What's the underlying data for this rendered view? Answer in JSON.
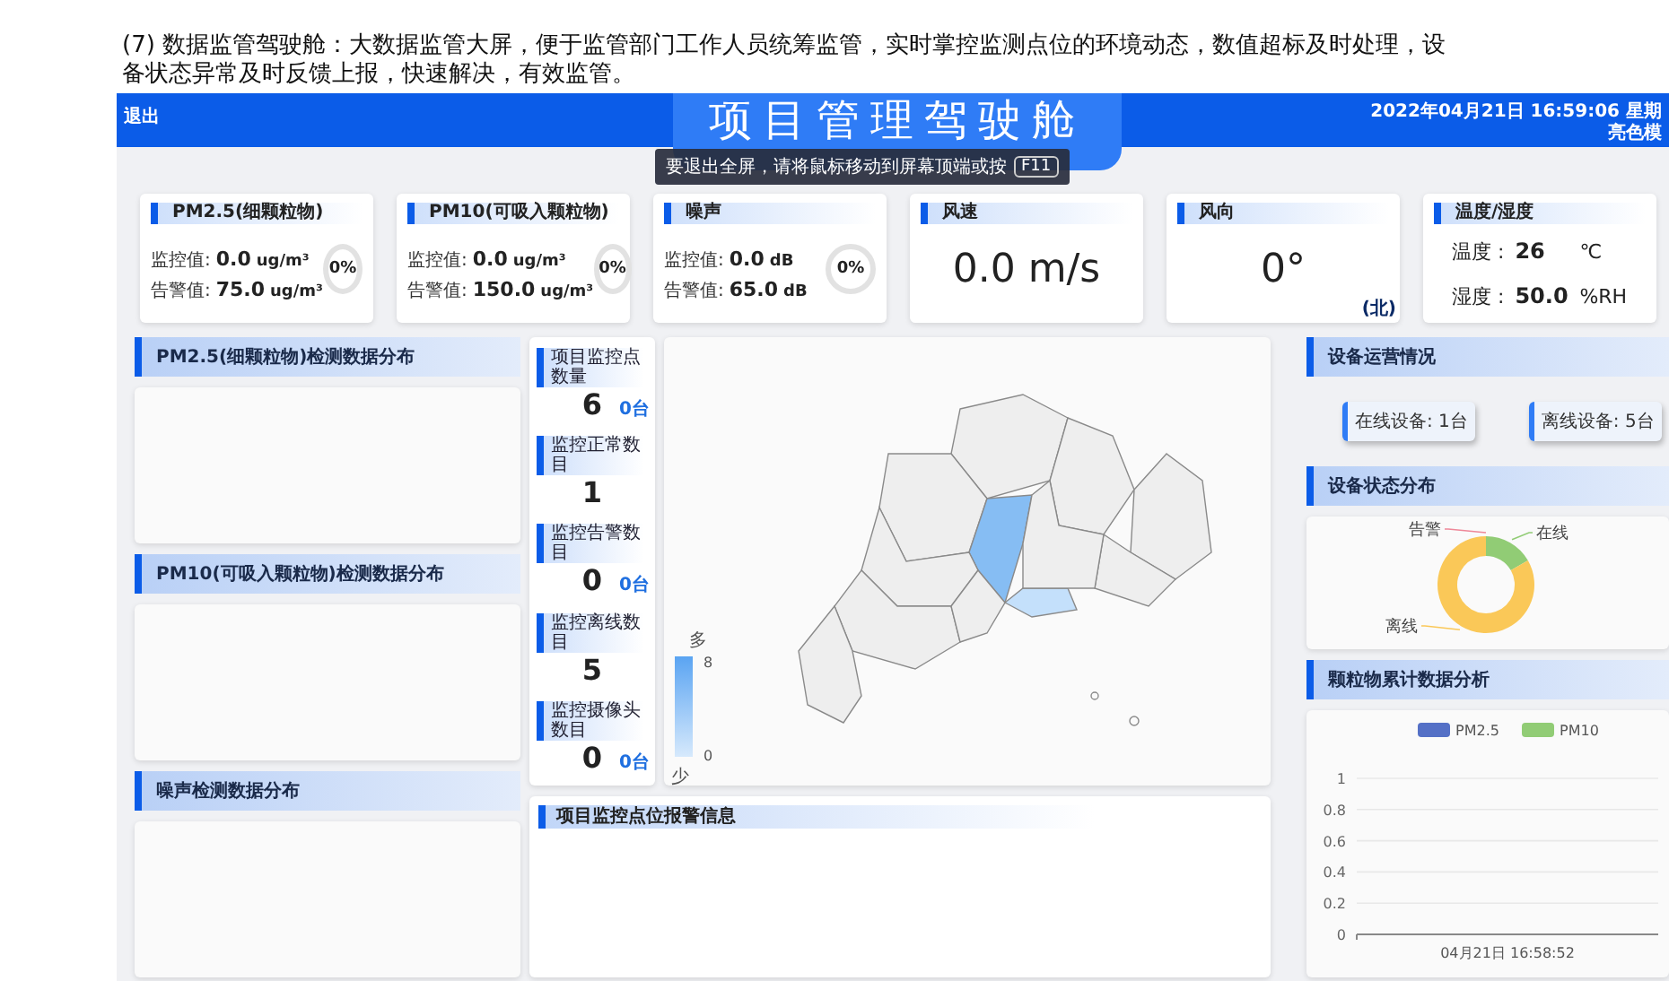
{
  "caption": "(7) 数据监管驾驶舱：大数据监管大屏，便于监管部门工作人员统筹监管，实时掌控监测点位的环境动态，数值超标及时处理，设备状态异常及时反馈上报，快速解决，有效监管。",
  "header": {
    "exit": "退出",
    "title": "项目管理驾驶舱",
    "tooltip": {
      "text": "要退出全屏，请将鼠标移动到屏幕顶端或按",
      "key": "F11"
    },
    "datetime": "2022年04月21日 16:59:06 星期",
    "theme": "亮色模"
  },
  "cards": [
    {
      "kind": "gauge",
      "title": "PM2.5(细颗粒物)",
      "rows": [
        {
          "label": "监控值:",
          "value": "0.0",
          "unit": "ug/m³"
        },
        {
          "label": "告警值:",
          "value": "75.0",
          "unit": "ug/m³"
        }
      ],
      "percent": "0%"
    },
    {
      "kind": "gauge",
      "title": "PM10(可吸入颗粒物)",
      "rows": [
        {
          "label": "监控值:",
          "value": "0.0",
          "unit": "ug/m³"
        },
        {
          "label": "告警值:",
          "value": "150.0",
          "unit": "ug/m³"
        }
      ],
      "percent": "0%"
    },
    {
      "kind": "gauge",
      "title": "噪声",
      "rows": [
        {
          "label": "监控值:",
          "value": "0.0",
          "unit": "dB"
        },
        {
          "label": "告警值:",
          "value": "65.0",
          "unit": "dB"
        }
      ],
      "percent": "0%"
    },
    {
      "kind": "big",
      "title": "风速",
      "value": "0.0 m/s"
    },
    {
      "kind": "big",
      "title": "风向",
      "value": "0°",
      "note": "(北)"
    },
    {
      "kind": "pairs",
      "title": "温度/湿度",
      "rows": [
        {
          "label": "温度 :",
          "value": "26",
          "unit": "℃"
        },
        {
          "label": "湿度 :",
          "value": "50.0",
          "unit": "%RH"
        }
      ]
    }
  ],
  "left_panels": [
    {
      "title": "PM2.5(细颗粒物)检测数据分布"
    },
    {
      "title": "PM10(可吸入颗粒物)检测数据分布"
    },
    {
      "title": "噪声检测数据分布"
    }
  ],
  "stats": [
    {
      "label": "项目监控点数量",
      "value": "6",
      "badge": "0台"
    },
    {
      "label": "监控正常数目",
      "value": "1"
    },
    {
      "label": "监控告警数目",
      "value": "0",
      "badge": "0台"
    },
    {
      "label": "监控离线数目",
      "value": "5"
    },
    {
      "label": "监控摄像头数目",
      "value": "0",
      "badge": "0台"
    }
  ],
  "map": {
    "legend": {
      "high_label": "多",
      "max": "8",
      "min": "0",
      "low_label": "少"
    }
  },
  "alerts": {
    "title": "项目监控点位报警信息"
  },
  "device_ops": {
    "title": "设备运营情况",
    "buttons": [
      "在线设备: 1台",
      "离线设备: 5台"
    ]
  },
  "device_status": {
    "title": "设备状态分布",
    "chart_data": {
      "type": "donut",
      "categories": [
        "告警",
        "在线",
        "离线"
      ],
      "values": [
        0,
        16.7,
        83.3
      ]
    }
  },
  "particles": {
    "title": "颗粒物累计数据分析",
    "chart_data": {
      "type": "line",
      "categories": [
        "04月21日 16:58:52"
      ],
      "series": [
        {
          "name": "PM2.5",
          "color": "#5470c6",
          "values": [
            null
          ]
        },
        {
          "name": "PM10",
          "color": "#91cc75",
          "values": [
            null
          ]
        }
      ],
      "grid": true,
      "ylim": [
        0,
        1
      ],
      "yticks": [
        0,
        0.2,
        0.4,
        0.6,
        0.8,
        1
      ]
    }
  }
}
